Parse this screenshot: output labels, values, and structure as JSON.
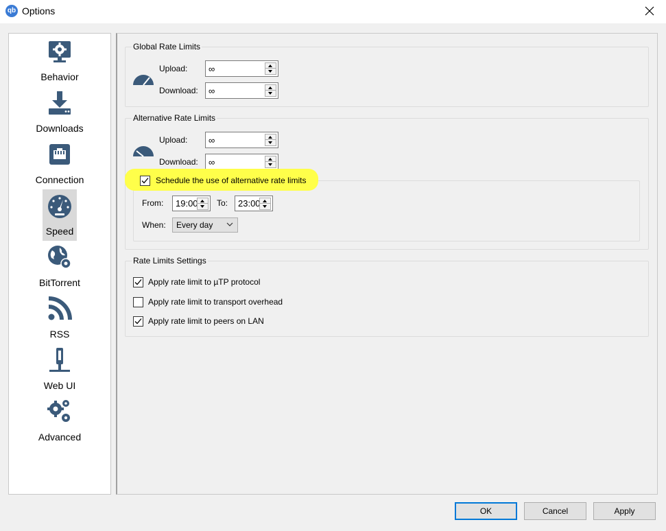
{
  "window": {
    "title": "Options",
    "app_icon_text": "qb"
  },
  "sidebar": {
    "items": [
      {
        "label": "Behavior",
        "icon": "monitor-gear-icon"
      },
      {
        "label": "Downloads",
        "icon": "download-tray-icon"
      },
      {
        "label": "Connection",
        "icon": "ethernet-port-icon"
      },
      {
        "label": "Speed",
        "icon": "speedometer-icon",
        "selected": true
      },
      {
        "label": "BitTorrent",
        "icon": "globe-gear-icon"
      },
      {
        "label": "RSS",
        "icon": "rss-feed-icon"
      },
      {
        "label": "Web UI",
        "icon": "network-plug-icon"
      },
      {
        "label": "Advanced",
        "icon": "gears-icon"
      }
    ]
  },
  "global": {
    "title": "Global Rate Limits",
    "upload_label": "Upload:",
    "upload_value": "∞",
    "download_label": "Download:",
    "download_value": "∞"
  },
  "alternative": {
    "title": "Alternative Rate Limits",
    "upload_label": "Upload:",
    "upload_value": "∞",
    "download_label": "Download:",
    "download_value": "∞",
    "schedule_label": "Schedule the use of alternative rate limits",
    "schedule_checked": true,
    "from_label": "From:",
    "from_value": "19:00",
    "to_label": "To:",
    "to_value": "23:00",
    "when_label": "When:",
    "when_value": "Every day"
  },
  "settings": {
    "title": "Rate Limits Settings",
    "utp_label": "Apply rate limit to µTP protocol",
    "utp_checked": true,
    "overhead_label": "Apply rate limit to transport overhead",
    "overhead_checked": false,
    "lan_label": "Apply rate limit to peers on LAN",
    "lan_checked": true
  },
  "buttons": {
    "ok": "OK",
    "cancel": "Cancel",
    "apply": "Apply"
  },
  "colors": {
    "icon": "#3b5a7a",
    "highlight": "#ffff4a",
    "focus": "#0078d7"
  }
}
